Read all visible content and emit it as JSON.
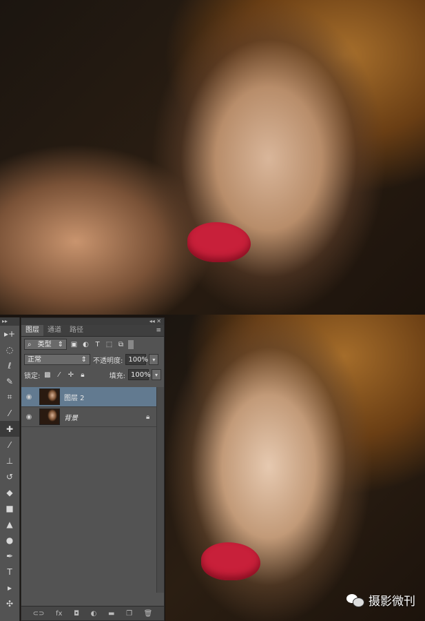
{
  "panel": {
    "tabs": [
      "图层",
      "通道",
      "路径"
    ],
    "filter_kind": "类型",
    "blend_mode": "正常",
    "opacity_label": "不透明度:",
    "opacity_value": "100%",
    "lock_label": "锁定:",
    "fill_label": "填充:",
    "fill_value": "100%",
    "layers": [
      {
        "name": "图层 2",
        "selected": true
      },
      {
        "name": "背景",
        "selected": false,
        "locked": true
      }
    ]
  },
  "watermark": "摄影微刊",
  "icons": {
    "toolbar": [
      "move-icon",
      "marquee-icon",
      "lasso-icon",
      "quick-select-icon",
      "crop-icon",
      "eyedropper-icon",
      "healing-brush-icon",
      "brush-icon",
      "stamp-icon",
      "history-brush-icon",
      "eraser-icon",
      "gradient-icon",
      "blur-icon",
      "dodge-icon",
      "pen-icon",
      "type-icon",
      "path-select-icon",
      "shape-icon"
    ]
  }
}
